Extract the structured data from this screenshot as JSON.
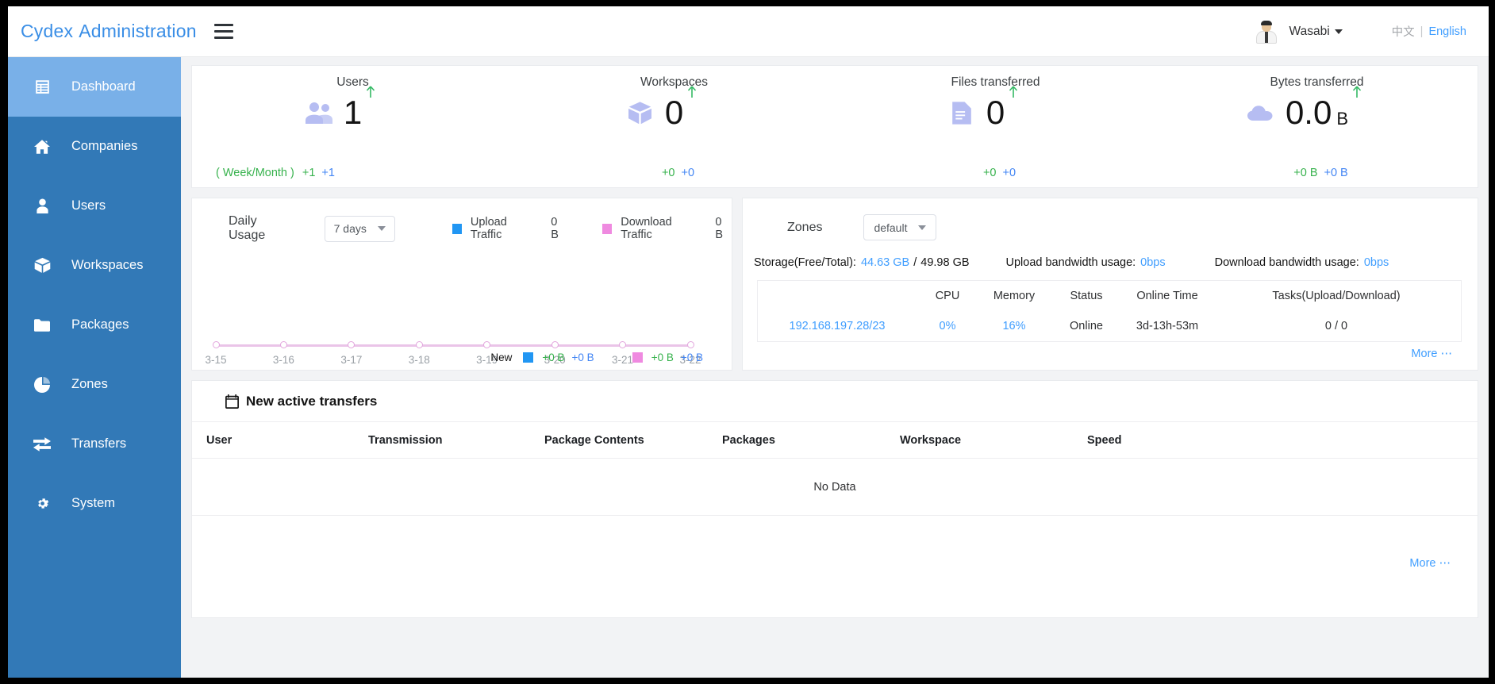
{
  "header": {
    "brand_1": "Cydex",
    "brand_2": "Administration",
    "menu_icon": "hamburger-icon",
    "username": "Wasabi",
    "lang_cn": "中文",
    "lang_sep": "|",
    "lang_en": "English"
  },
  "sidebar": {
    "items": [
      {
        "label": "Dashboard",
        "icon": "dashboard-icon",
        "active": true
      },
      {
        "label": "Companies",
        "icon": "home-icon",
        "active": false
      },
      {
        "label": "Users",
        "icon": "user-icon",
        "active": false
      },
      {
        "label": "Workspaces",
        "icon": "box-icon",
        "active": false
      },
      {
        "label": "Packages",
        "icon": "folder-icon",
        "active": false
      },
      {
        "label": "Zones",
        "icon": "pie-chart-icon",
        "active": false
      },
      {
        "label": "Transfers",
        "icon": "exchange-icon",
        "active": false
      },
      {
        "label": "System",
        "icon": "gear-icon",
        "active": false
      }
    ]
  },
  "stats": {
    "week_month_label": "( Week/Month )",
    "cards": [
      {
        "title": "Users",
        "value": "1",
        "unit": "",
        "icon": "users-icon",
        "delta_week": "+1",
        "delta_month": "+1"
      },
      {
        "title": "Workspaces",
        "value": "0",
        "unit": "",
        "icon": "box-icon",
        "delta_week": "+0",
        "delta_month": "+0"
      },
      {
        "title": "Files transferred",
        "value": "0",
        "unit": "",
        "icon": "document-icon",
        "delta_week": "+0",
        "delta_month": "+0"
      },
      {
        "title": "Bytes transferred",
        "value": "0.0",
        "unit": "B",
        "icon": "cloud-icon",
        "delta_week": "+0 B",
        "delta_month": "+0 B"
      }
    ]
  },
  "usage": {
    "title": "Daily Usage",
    "range_value": "7 days",
    "legend": [
      {
        "label": "Upload Traffic",
        "value": "0 B",
        "color": "#2196f3"
      },
      {
        "label": "Download Traffic",
        "value": "0 B",
        "color": "#ef8ae0"
      }
    ],
    "footer": {
      "new_label": "New",
      "upload_delta_green": "+0 B",
      "upload_delta_blue": "+0 B",
      "download_delta_green": "+0 B",
      "download_delta_blue": "+0 B"
    }
  },
  "chart_data": {
    "type": "line",
    "title": "Daily Usage",
    "x": [
      "3-15",
      "3-16",
      "3-17",
      "3-18",
      "3-19",
      "3-20",
      "3-21",
      "3-22"
    ],
    "series": [
      {
        "name": "Upload Traffic",
        "values": [
          0,
          0,
          0,
          0,
          0,
          0,
          0,
          0
        ],
        "color": "#2196f3",
        "unit": "B"
      },
      {
        "name": "Download Traffic",
        "values": [
          0,
          0,
          0,
          0,
          0,
          0,
          0,
          0
        ],
        "color": "#ef8ae0",
        "unit": "B"
      }
    ],
    "xlabel": "",
    "ylabel": "",
    "ylim": [
      0,
      0
    ],
    "grid": false,
    "legend_position": "top-right",
    "range": "7 days"
  },
  "zones": {
    "title": "Zones",
    "selected": "default",
    "storage_label": "Storage(Free/Total):",
    "storage_free": "44.63 GB",
    "storage_sep": "/",
    "storage_total": "49.98 GB",
    "upload_bw_label": "Upload bandwidth usage:",
    "upload_bw_value": "0bps",
    "download_bw_label": "Download bandwidth usage:",
    "download_bw_value": "0bps",
    "columns": [
      "",
      "CPU",
      "Memory",
      "Status",
      "Online Time",
      "Tasks(Upload/Download)"
    ],
    "rows": [
      {
        "address": "192.168.197.28/23",
        "cpu": "0%",
        "memory": "16%",
        "status": "Online",
        "online_time": "3d-13h-53m",
        "tasks": "0 / 0"
      }
    ],
    "more_label": "More ⋯"
  },
  "transfers": {
    "title": "New active transfers",
    "icon": "calendar-icon",
    "columns": [
      "User",
      "Transmission",
      "Package Contents",
      "Packages",
      "Workspace",
      "Speed"
    ],
    "empty_text": "No Data",
    "more_label": "More ⋯"
  }
}
